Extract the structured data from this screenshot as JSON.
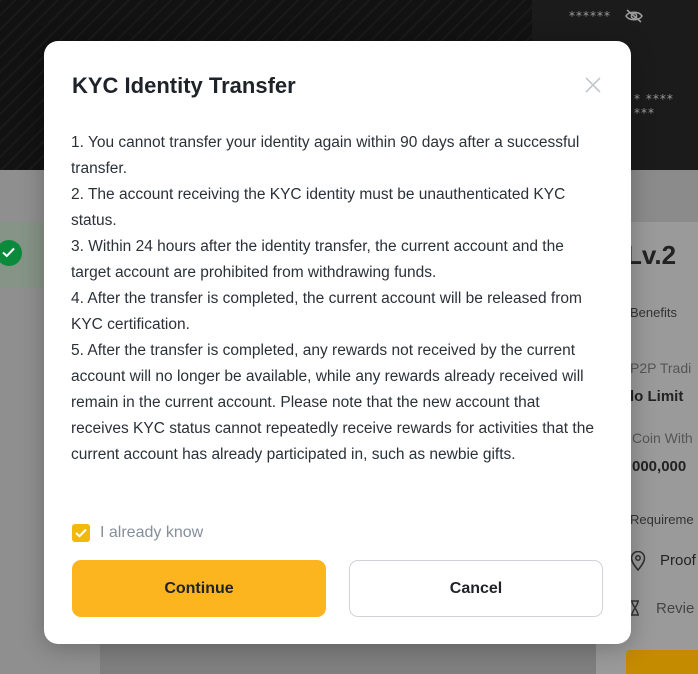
{
  "background": {
    "masked_1": "****** ",
    "masked_2": "* **** ***",
    "level": "Lv.2",
    "benefits": "Benefits",
    "p2p": "P2P Tradi",
    "p2p_value": "lo Limit",
    "coin": "Coin With",
    "coin_value": "000,000",
    "requirements": "Requireme",
    "proof": "Proof",
    "review": "Revie"
  },
  "modal": {
    "title": "KYC Identity Transfer",
    "close_icon": "close-icon",
    "paragraphs": [
      "1. You cannot transfer your identity again within 90 days after a successful transfer.",
      "2. The account receiving the KYC identity must be unauthenticated KYC status.",
      "3. Within 24 hours after the identity transfer, the current account and the target account are prohibited from withdrawing funds.",
      "4. After the transfer is completed, the current account will be released from KYC certification.",
      "5. After the transfer is completed, any rewards not received by the current account will no longer be available, while any rewards already received will remain in the current account. Please note that the new account that receives KYC status cannot repeatedly receive rewards for activities that the current account has already participated in, such as newbie gifts."
    ],
    "checkbox_label": "I already know",
    "checkbox_checked": true,
    "continue_label": "Continue",
    "cancel_label": "Cancel"
  },
  "colors": {
    "accent": "#fcb41f",
    "checkbox": "#f0b90b",
    "text": "#1e2329",
    "muted": "#848e9c"
  }
}
